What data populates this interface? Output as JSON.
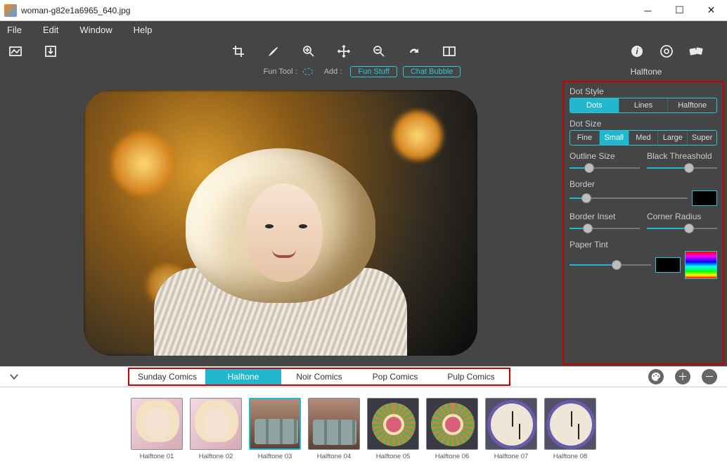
{
  "window": {
    "title": "woman-g82e1a6965_640.jpg"
  },
  "menu": {
    "file": "File",
    "edit": "Edit",
    "window": "Window",
    "help": "Help"
  },
  "funrow": {
    "funtool": "Fun Tool :",
    "add": "Add :",
    "funstuff": "Fun Stuff",
    "chatbubble": "Chat Bubble",
    "paneltitle": "Halftone"
  },
  "panel": {
    "dotstyle_label": "Dot Style",
    "dotstyle": {
      "dots": "Dots",
      "lines": "Lines",
      "halftone": "Halftone",
      "active": 0
    },
    "dotsize_label": "Dot Size",
    "dotsize": {
      "fine": "Fine",
      "small": "Small",
      "med": "Med",
      "large": "Large",
      "super": "Super",
      "active": 1
    },
    "outline_label": "Outline Size",
    "black_label": "Black Threashold",
    "border_label": "Border",
    "inset_label": "Border Inset",
    "corner_label": "Corner Radius",
    "tint_label": "Paper Tint",
    "sliders": {
      "outline": 28,
      "black": 60,
      "border": 14,
      "inset": 26,
      "corner": 60,
      "tint": 58
    }
  },
  "tabs": {
    "items": [
      {
        "label": "Sunday Comics"
      },
      {
        "label": "Halftone"
      },
      {
        "label": "Noir Comics"
      },
      {
        "label": "Pop Comics"
      },
      {
        "label": "Pulp Comics"
      }
    ],
    "active": 1
  },
  "thumbs": [
    {
      "label": "Halftone 01",
      "kind": "face"
    },
    {
      "label": "Halftone 02",
      "kind": "face"
    },
    {
      "label": "Halftone 03",
      "kind": "cans",
      "selected": true
    },
    {
      "label": "Halftone 04",
      "kind": "cans"
    },
    {
      "label": "Halftone 05",
      "kind": "wheel"
    },
    {
      "label": "Halftone 06",
      "kind": "wheel"
    },
    {
      "label": "Halftone 07",
      "kind": "clock"
    },
    {
      "label": "Halftone 08",
      "kind": "clock"
    }
  ]
}
